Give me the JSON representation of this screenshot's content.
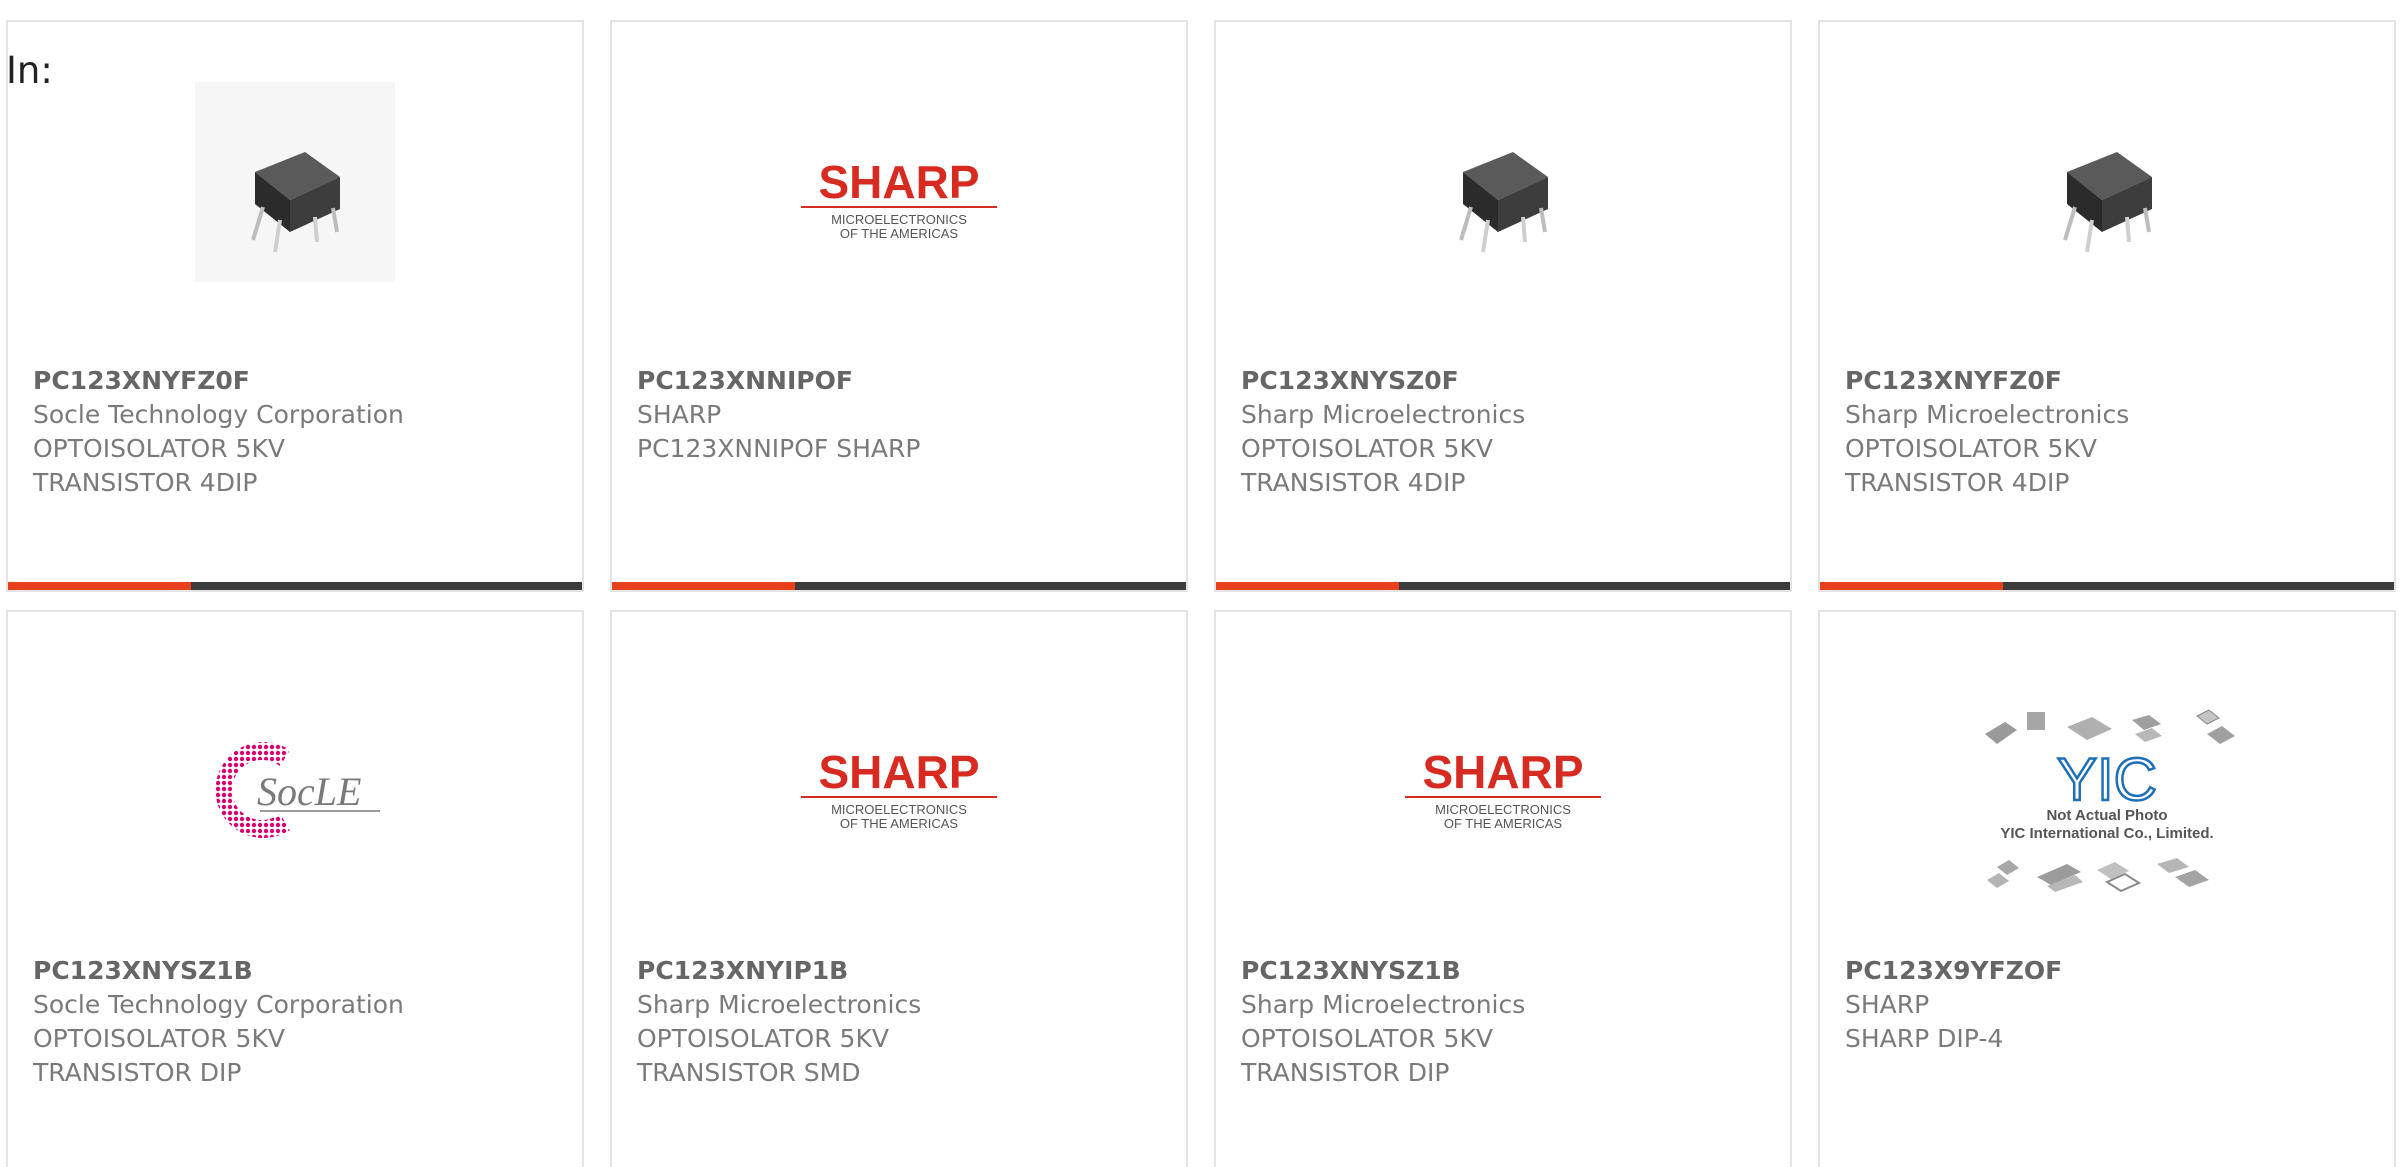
{
  "header": {
    "label": "In:"
  },
  "colors": {
    "accent": "#e8401c",
    "bar": "#3c3c3c",
    "sharp_red": "#d72b22",
    "socle_pink": "#d6006e",
    "yic_blue": "#1d6fb8"
  },
  "products": [
    {
      "part": "PC123XNYFZ0F",
      "maker": "Socle Technology Corporation",
      "desc1": "OPTOISOLATOR 5KV",
      "desc2": "TRANSISTOR 4DIP",
      "image": "dip4-component-photo"
    },
    {
      "part": "PC123XNNIPOF",
      "maker": "SHARP",
      "desc1": "PC123XNNIPOF SHARP",
      "desc2": "",
      "image": "sharp-logo",
      "logo": {
        "brand": "SHARP",
        "sub1": "MICROELECTRONICS",
        "sub2": "OF THE AMERICAS"
      }
    },
    {
      "part": "PC123XNYSZ0F",
      "maker": "Sharp Microelectronics",
      "desc1": "OPTOISOLATOR 5KV",
      "desc2": "TRANSISTOR 4DIP",
      "image": "dip4-component-photo"
    },
    {
      "part": "PC123XNYFZ0F",
      "maker": "Sharp Microelectronics",
      "desc1": "OPTOISOLATOR 5KV",
      "desc2": "TRANSISTOR 4DIP",
      "image": "dip4-component-photo"
    },
    {
      "part": "PC123XNYSZ1B",
      "maker": "Socle Technology Corporation",
      "desc1": "OPTOISOLATOR 5KV",
      "desc2": "TRANSISTOR DIP",
      "image": "socle-logo",
      "logo": {
        "brand": "SocLE"
      }
    },
    {
      "part": "PC123XNYIP1B",
      "maker": "Sharp Microelectronics",
      "desc1": "OPTOISOLATOR 5KV",
      "desc2": "TRANSISTOR SMD",
      "image": "sharp-logo",
      "logo": {
        "brand": "SHARP",
        "sub1": "MICROELECTRONICS",
        "sub2": "OF THE AMERICAS"
      }
    },
    {
      "part": "PC123XNYSZ1B",
      "maker": "Sharp Microelectronics",
      "desc1": "OPTOISOLATOR 5KV",
      "desc2": "TRANSISTOR DIP",
      "image": "sharp-logo",
      "logo": {
        "brand": "SHARP",
        "sub1": "MICROELECTRONICS",
        "sub2": "OF THE AMERICAS"
      }
    },
    {
      "part": "PC123X9YFZOF",
      "maker": "SHARP",
      "desc1": "SHARP DIP-4",
      "desc2": "",
      "image": "yic-placeholder",
      "logo": {
        "brand": "YIC",
        "sub1": "Not Actual Photo",
        "sub2": "YIC International Co., Limited."
      }
    }
  ]
}
